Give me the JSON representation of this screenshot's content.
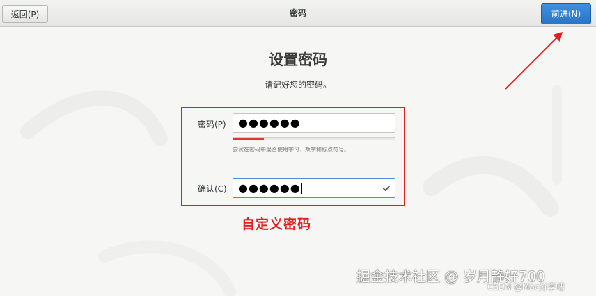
{
  "header": {
    "back_label": "返回(P)",
    "title": "密码",
    "next_label": "前进(N)"
  },
  "main": {
    "title": "设置密码",
    "subtitle": "请记好您的密码。",
    "password": {
      "label": "密码(P)",
      "value_masked": "●●●●●●",
      "strength": 0.19,
      "hint": "尝试在密码中混合使用字母、数字和标点符号。"
    },
    "confirm": {
      "label": "确认(C)",
      "value_masked": "●●●●●●",
      "status_icon": "check-icon"
    }
  },
  "annotation": {
    "label": "自定义密码",
    "color": "#e02020"
  },
  "watermark": {
    "main": "掘金技术社区 @ 岁月静好700",
    "sub": "CSDN @Mac分享吧"
  },
  "colors": {
    "accent": "#2a76c6",
    "strength_weak": "#d63b2e"
  }
}
